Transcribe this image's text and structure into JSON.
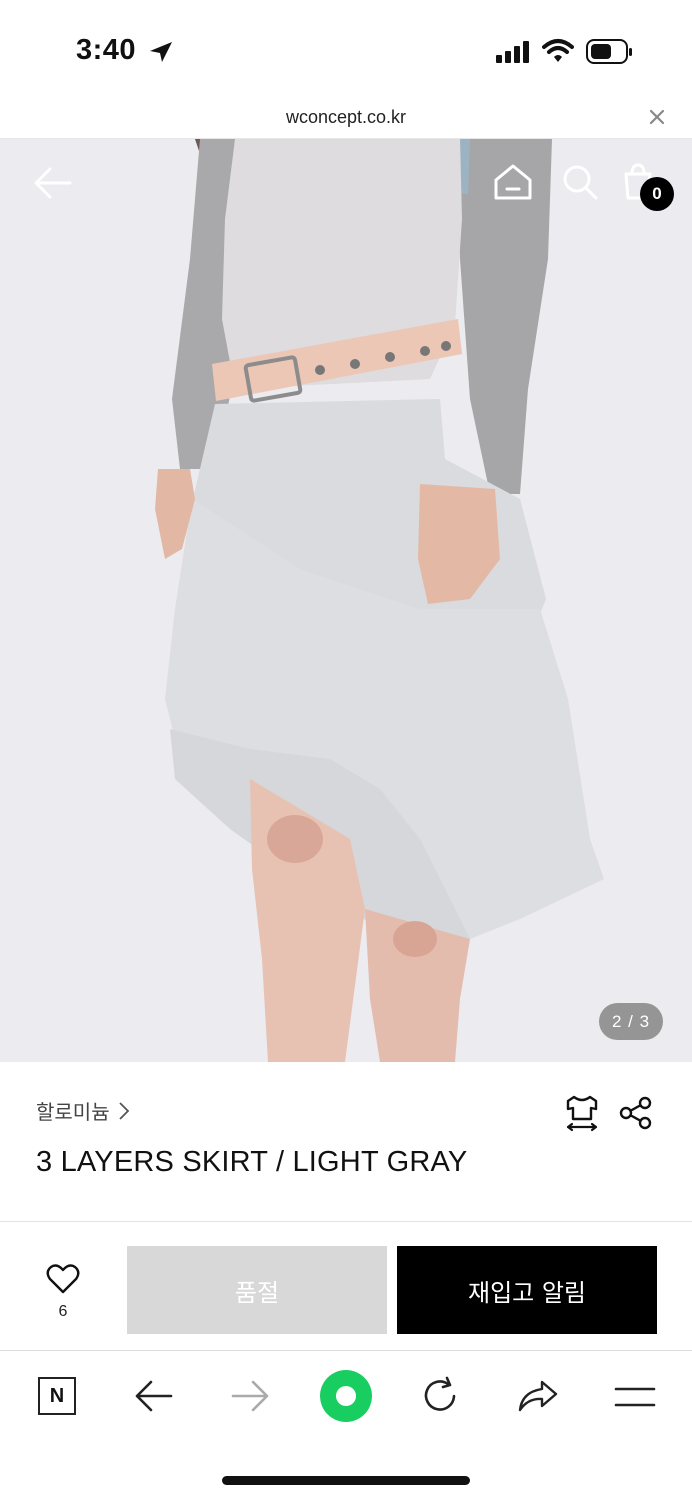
{
  "status_bar": {
    "time": "3:40"
  },
  "browser": {
    "url": "wconcept.co.kr"
  },
  "header": {
    "cart_count": "0"
  },
  "gallery": {
    "page_indicator": "2 / 3"
  },
  "product": {
    "brand": "할로미늄",
    "name": "3 LAYERS SKIRT / LIGHT GRAY"
  },
  "actions": {
    "wish_count": "6",
    "soldout_label": "품절",
    "restock_label": "재입고 알림"
  },
  "toolbar": {
    "n_label": "N"
  },
  "colors": {
    "accent_green": "#19ce60",
    "primary_black": "#000000",
    "disabled_gray": "#d8d8d8"
  }
}
